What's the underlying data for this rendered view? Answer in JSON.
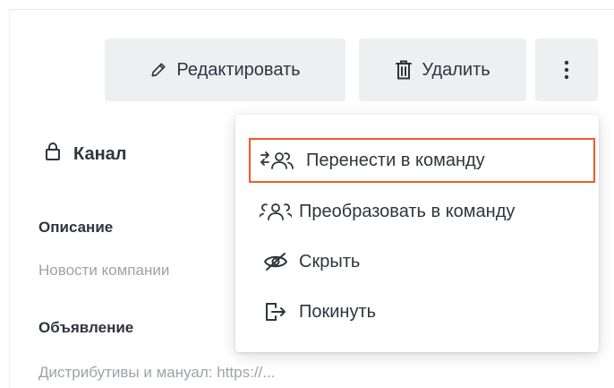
{
  "toolbar": {
    "edit_label": "Редактировать",
    "delete_label": "Удалить",
    "edit_icon": "pencil-icon",
    "delete_icon": "trash-icon",
    "more_icon": "kebab-icon"
  },
  "room": {
    "title": "Канал",
    "lock_icon": "lock-icon"
  },
  "sections": {
    "description_label": "Описание",
    "description_value": "Новости компании",
    "announcement_label": "Объявление",
    "announcement_value": "Дистрибутивы и мануал: https://..."
  },
  "menu": {
    "items": [
      {
        "label": "Перенести в команду",
        "icon": "move-to-team-icon",
        "selected": true
      },
      {
        "label": "Преобразовать в команду",
        "icon": "team-icon",
        "selected": false
      },
      {
        "label": "Скрыть",
        "icon": "eye-off-icon",
        "selected": false
      },
      {
        "label": "Покинуть",
        "icon": "leave-icon",
        "selected": false
      }
    ]
  },
  "colors": {
    "text": "#2f343d",
    "muted": "#9ea2a8",
    "button_bg": "#eeeff1",
    "highlight": "#f05a28"
  }
}
